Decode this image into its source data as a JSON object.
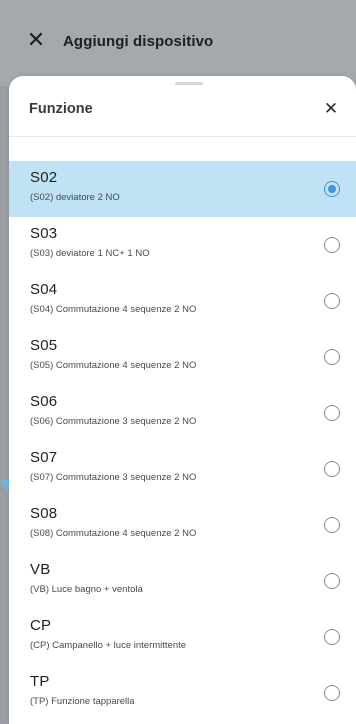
{
  "topbar": {
    "close_icon": "close-icon",
    "title": "Aggiungi dispositivo"
  },
  "sheet": {
    "title": "Funzione",
    "close_icon": "close-icon"
  },
  "options": [
    {
      "code": "S02",
      "desc": "(S02) deviatore 2 NO",
      "selected": true
    },
    {
      "code": "S03",
      "desc": "(S03) deviatore 1 NC+ 1 NO",
      "selected": false
    },
    {
      "code": "S04",
      "desc": "(S04) Commutazione 4 sequenze 2 NO",
      "selected": false
    },
    {
      "code": "S05",
      "desc": "(S05) Commutazione 4 sequenze 2 NO",
      "selected": false
    },
    {
      "code": "S06",
      "desc": "(S06) Commutazione 3 sequenze 2 NO",
      "selected": false
    },
    {
      "code": "S07",
      "desc": "(S07) Commutazione 3 sequenze 2 NO",
      "selected": false
    },
    {
      "code": "S08",
      "desc": "(S08) Commutazione 4 sequenze 2 NO",
      "selected": false
    },
    {
      "code": "VB",
      "desc": "(VB) Luce bagno + ventola",
      "selected": false
    },
    {
      "code": "CP",
      "desc": "(CP) Campanello + luce intermittente",
      "selected": false
    },
    {
      "code": "TP",
      "desc": "(TP) Funzione tapparella",
      "selected": false
    }
  ],
  "colors": {
    "selected_row": "#bfe2f5",
    "accent": "#3b95d6",
    "overlay": "#9fa3a8"
  }
}
